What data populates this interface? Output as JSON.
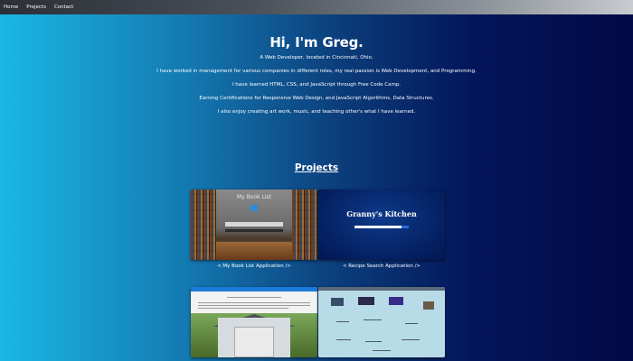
{
  "nav": {
    "items": [
      {
        "label": "Home"
      },
      {
        "label": "Projects"
      },
      {
        "label": "Contact"
      }
    ]
  },
  "hero": {
    "title": "Hi, I'm Greg.",
    "subtitle": "A Web Developer, located in Cincinnati, Ohio.",
    "paragraphs": [
      "I have worked in management for various companies in different roles, my real passion is Web Development, and Programming.",
      "I have learned HTML, CSS, and JavaScript through Free Code Camp.",
      "Earning Certifications for Responsive Web Design, and JavaScript Algorithms, Data Structures.",
      "I also enjoy creating art work, music, and teaching other's what I have learned."
    ]
  },
  "projects": {
    "heading": "Projects",
    "cards": [
      {
        "caption": "< My Book List Application />",
        "thumb_title": "My Book List"
      },
      {
        "caption": "< Recipe Search Application />",
        "thumb_title": "Granny's Kitchen"
      },
      {
        "caption": ""
      },
      {
        "caption": ""
      }
    ]
  },
  "colors": {
    "bg_left": "#1ab8e4",
    "bg_right": "#010a45",
    "navbar": "#2b2f36"
  }
}
